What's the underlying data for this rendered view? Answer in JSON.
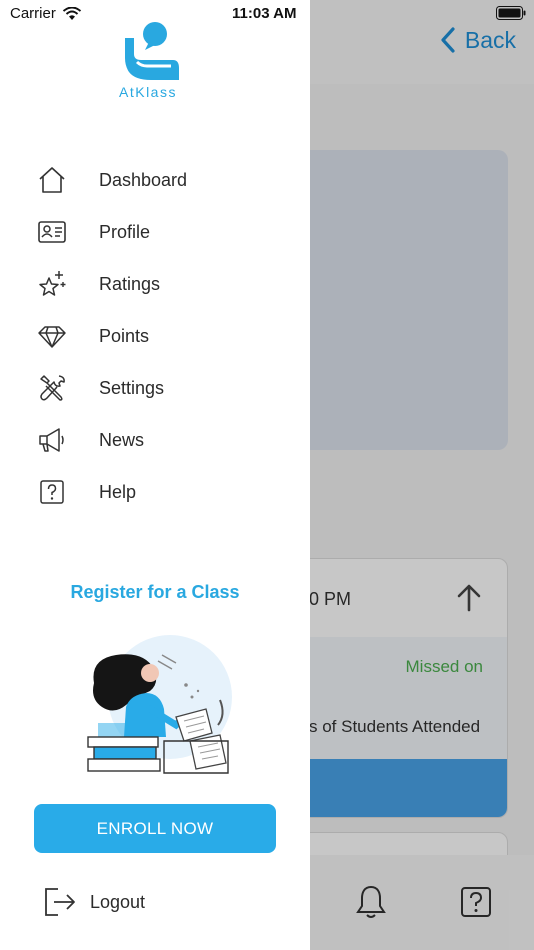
{
  "status_bar": {
    "carrier": "Carrier",
    "time": "11:03 AM"
  },
  "background": {
    "back_label": "Back",
    "session_time": "0 PM",
    "missed_label": "Missed on",
    "attended_label": "s of Students Attended"
  },
  "drawer": {
    "logo_text": "AtKlass",
    "menu": [
      {
        "label": "Dashboard",
        "icon": "home-icon"
      },
      {
        "label": "Profile",
        "icon": "id-card-icon"
      },
      {
        "label": "Ratings",
        "icon": "star-sparkle-icon"
      },
      {
        "label": "Points",
        "icon": "diamond-icon"
      },
      {
        "label": "Settings",
        "icon": "tools-icon"
      },
      {
        "label": "News",
        "icon": "megaphone-icon"
      },
      {
        "label": "Help",
        "icon": "help-icon"
      }
    ],
    "register_title": "Register for a Class",
    "enroll_label": "ENROLL NOW",
    "logout_label": "Logout"
  },
  "colors": {
    "accent": "#29abe8",
    "missed": "#4caf50",
    "back": "#1e8fd6"
  }
}
